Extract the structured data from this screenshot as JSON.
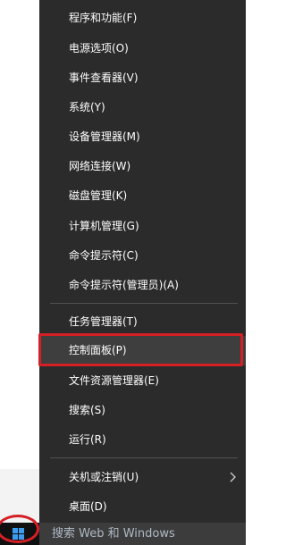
{
  "menu": {
    "items": [
      {
        "label": "程序和功能(F)"
      },
      {
        "label": "电源选项(O)"
      },
      {
        "label": "事件查看器(V)"
      },
      {
        "label": "系统(Y)"
      },
      {
        "label": "设备管理器(M)"
      },
      {
        "label": "网络连接(W)"
      },
      {
        "label": "磁盘管理(K)"
      },
      {
        "label": "计算机管理(G)"
      },
      {
        "label": "命令提示符(C)"
      },
      {
        "label": "命令提示符(管理员)(A)"
      },
      {
        "label": "任务管理器(T)"
      },
      {
        "label": "控制面板(P)",
        "highlighted": true
      },
      {
        "label": "文件资源管理器(E)"
      },
      {
        "label": "搜索(S)"
      },
      {
        "label": "运行(R)"
      },
      {
        "label": "关机或注销(U)",
        "has_submenu": true,
        "submenu_icon": "chevron-right-icon"
      },
      {
        "label": "桌面(D)"
      }
    ]
  },
  "taskbar": {
    "start_icon": "windows-logo-icon",
    "search_placeholder": "搜索 Web 和 Windows"
  },
  "colors": {
    "menu_background": "#2b2b2b",
    "menu_text": "#ffffff",
    "highlight_ring": "#d41f25",
    "windows_logo": "#3b9cf0",
    "taskbar": "#101010"
  }
}
